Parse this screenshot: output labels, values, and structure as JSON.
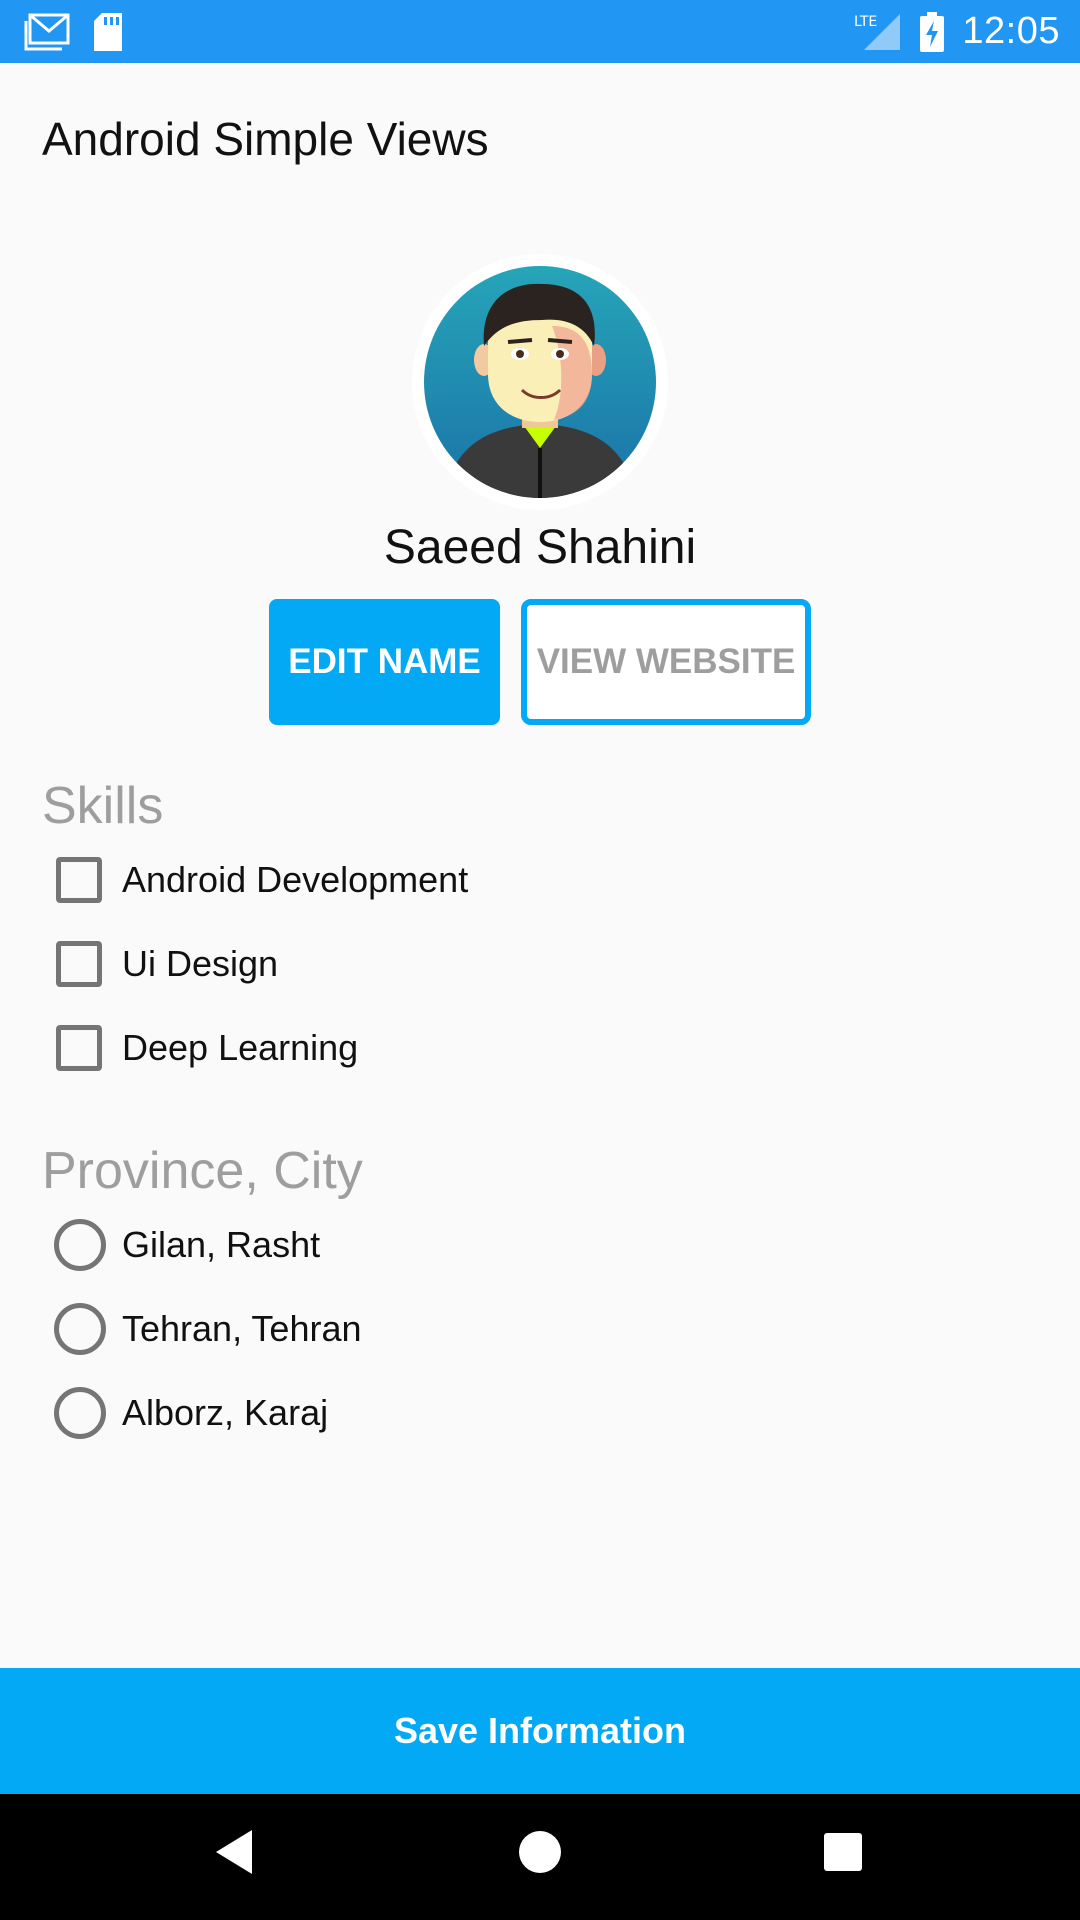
{
  "status_bar": {
    "time": "12:05",
    "network": "LTE",
    "icons": [
      "gmail-icon",
      "sd-card-icon",
      "lte-signal-icon",
      "battery-charging-icon"
    ],
    "color": "#2196f3"
  },
  "app": {
    "title": "Android Simple Views"
  },
  "profile": {
    "avatar_icon": "avatar-icon",
    "name": "Saeed Shahini"
  },
  "buttons": {
    "edit_name": "EDIT NAME",
    "view_website": "VIEW WEBSITE",
    "accent": "#03a9f4"
  },
  "skills": {
    "title": "Skills",
    "items": [
      {
        "label": "Android Development",
        "checked": false
      },
      {
        "label": "Ui Design",
        "checked": false
      },
      {
        "label": "Deep Learning",
        "checked": false
      }
    ]
  },
  "location": {
    "title": "Province, City",
    "options": [
      {
        "label": "Gilan, Rasht",
        "selected": false
      },
      {
        "label": "Tehran, Tehran",
        "selected": false
      },
      {
        "label": "Alborz, Karaj",
        "selected": false
      }
    ]
  },
  "save": {
    "label": "Save Information"
  },
  "nav_bar": {
    "icons": [
      "back-icon",
      "home-icon",
      "recents-icon"
    ]
  }
}
